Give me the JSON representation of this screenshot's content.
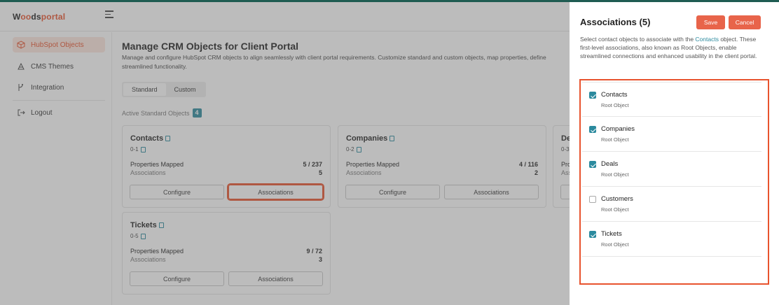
{
  "header": {
    "logo_part1": "W",
    "logo_accent1": "o",
    "logo_accent2": "o",
    "logo_part2": "ds",
    "logo_part3": "portal"
  },
  "sidebar": {
    "items": [
      {
        "label": "HubSpot Objects",
        "icon": "cube-icon"
      },
      {
        "label": "CMS Themes",
        "icon": "theme-icon"
      },
      {
        "label": "Integration",
        "icon": "integration-icon"
      },
      {
        "label": "Logout",
        "icon": "logout-icon"
      }
    ]
  },
  "main": {
    "title": "Manage CRM Objects for Client Portal",
    "description": "Manage and configure HubSpot CRM objects to align seamlessly with client portal requirements. Customize standard and custom objects, map properties, define streamlined functionality.",
    "tabs": [
      "Standard",
      "Custom"
    ],
    "active_label": "Active Standard Objects",
    "active_count": "4",
    "cards": [
      {
        "title": "Contacts",
        "id": "0-1",
        "props_label": "Properties Mapped",
        "props_value": "5 / 237",
        "assoc_label": "Associations",
        "assoc_value": "5",
        "configure": "Configure",
        "associations": "Associations"
      },
      {
        "title": "Companies",
        "id": "0-2",
        "props_label": "Properties Mapped",
        "props_value": "4 / 116",
        "assoc_label": "Associations",
        "assoc_value": "2",
        "configure": "Configure",
        "associations": "Associations"
      },
      {
        "title": "Tickets",
        "id": "0-5",
        "props_label": "Properties Mapped",
        "props_value": "9 / 72",
        "assoc_label": "Associations",
        "assoc_value": "3",
        "configure": "Configure",
        "associations": "Associations"
      },
      {
        "title": "De",
        "id": "0-3",
        "props_label": "Pro",
        "assoc_label": "Ass"
      }
    ]
  },
  "panel": {
    "title": "Associations (5)",
    "save": "Save",
    "cancel": "Cancel",
    "desc_before": "Select contact objects to associate with the ",
    "desc_link": "Contacts",
    "desc_after": " object. These first-level associations, also known as Root Objects, enable streamlined connections and enhanced usability in the client portal.",
    "items": [
      {
        "name": "Contacts",
        "sub": "Root Object",
        "checked": true
      },
      {
        "name": "Companies",
        "sub": "Root Object",
        "checked": true
      },
      {
        "name": "Deals",
        "sub": "Root Object",
        "checked": true
      },
      {
        "name": "Customers",
        "sub": "Root Object",
        "checked": false
      },
      {
        "name": "Tickets",
        "sub": "Root Object",
        "checked": true
      }
    ]
  },
  "colors": {
    "accent": "#e8532e",
    "teal": "#2b8a9e",
    "button": "#e8644a"
  }
}
